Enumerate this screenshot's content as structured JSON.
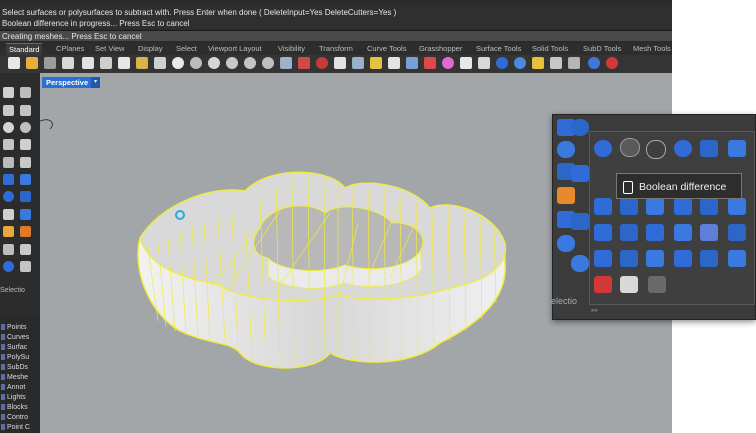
{
  "command_history": [
    "Select surfaces or polysurfaces to subtract with. Press Enter when done ( DeleteInput=Yes  DeleteCutters=Yes )",
    "Boolean difference in progress... Press Esc to cancel",
    "Creating meshes... Press Esc to cancel"
  ],
  "tabs": [
    "Standard",
    "CPlanes",
    "Set View",
    "Display",
    "Select",
    "Viewport Layout",
    "Visibility",
    "Transform",
    "Curve Tools",
    "Grasshopper",
    "Surface Tools",
    "Solid Tools",
    "SubD Tools",
    "Mesh Tools"
  ],
  "active_tab": "Standard",
  "viewport": {
    "label": "Perspective",
    "menu_arrow": "▾"
  },
  "selection_label": "Selectio",
  "layers": [
    "Points",
    "Curves",
    "Surfac",
    "PolySu",
    "SubDs",
    "Meshe",
    "Annot",
    "Lights",
    "Blocks",
    "Contro",
    "Point C"
  ],
  "flyout": {
    "tooltip": "Boolean difference",
    "selection_label": "electio",
    "footer": "»»"
  },
  "colors": {
    "viewport_bg": "#a3a6a9",
    "wire": "#f0ec3c",
    "active_tab_label": "#2a6fd1",
    "solid_icon": "#2f6cd8"
  }
}
